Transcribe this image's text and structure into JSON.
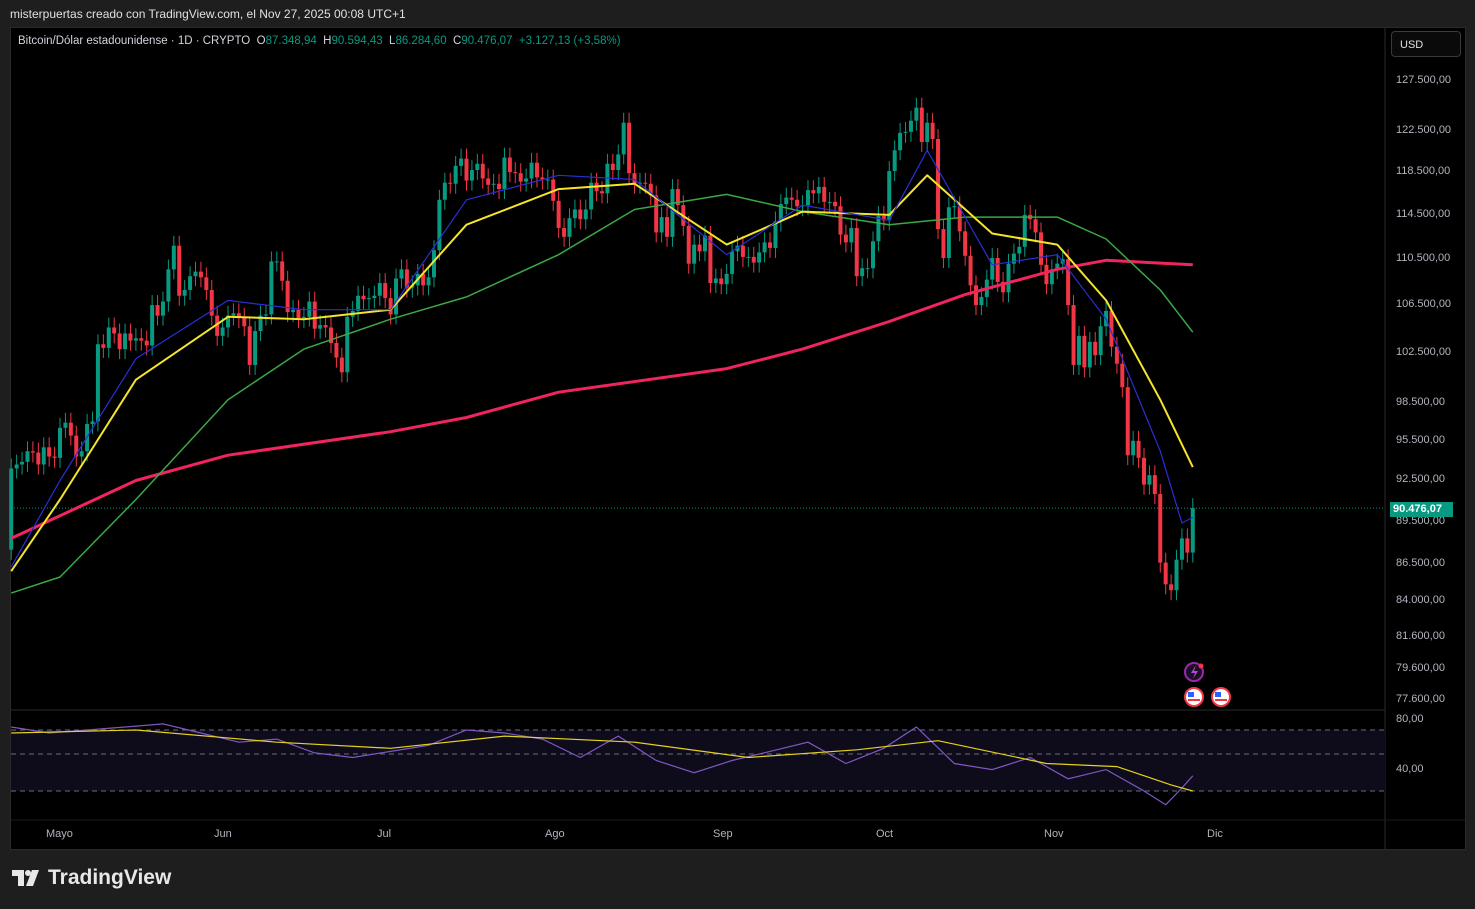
{
  "credit": "misterpuertas creado con TradingView.com, el Nov 27, 2025 00:08 UTC+1",
  "legend": {
    "symbol": "Bitcoin/Dólar estadounidense · 1D · CRYPTO",
    "o_label": "O",
    "o": "87.348,94",
    "h_label": "H",
    "h": "90.594,43",
    "l_label": "L",
    "l": "86.284,60",
    "c_label": "C",
    "c": "90.476,07",
    "change": "+3.127,13 (+3,58%)"
  },
  "currency": "USD",
  "last_price": "90.476,07",
  "colors": {
    "up": "#089981",
    "down": "#f23645",
    "ma10": "#2a2fd6",
    "ma20": "#f5e52a",
    "ma50": "#3aa845",
    "ma200": "#f0245e",
    "rsi": "#7e57c2",
    "rsi_ma": "#e6d21e"
  },
  "price_axis": [
    "127.500,00",
    "122.500,00",
    "118.500,00",
    "114.500,00",
    "110.500,00",
    "106.500,00",
    "102.500,00",
    "98.500,00",
    "95.500,00",
    "92.500,00",
    "89.500,00",
    "86.500,00",
    "84.000,00",
    "81.600,00",
    "79.600,00",
    "77.600,00"
  ],
  "rsi_axis": [
    "80,00",
    "40,00"
  ],
  "time_axis": [
    "Mayo",
    "Jun",
    "Jul",
    "Ago",
    "Sep",
    "Oct",
    "Nov",
    "Dic"
  ],
  "brand": "TradingView",
  "chart_data": {
    "type": "candlestick",
    "scale": "log",
    "ylim": [
      77000,
      128500
    ],
    "start_date": "2025-04-22",
    "first_open": 87500,
    "closes": [
      93.4,
      93.7,
      93.9,
      94.7,
      94.6,
      93.7,
      95.0,
      94.3,
      94.2,
      96.5,
      96.9,
      95.9,
      94.3,
      94.7,
      96.8,
      97.0,
      103.2,
      102.9,
      104.6,
      104.1,
      102.8,
      104.1,
      103.5,
      103.7,
      103.5,
      103.1,
      106.5,
      105.6,
      106.8,
      109.6,
      111.7,
      107.3,
      107.8,
      109.0,
      109.4,
      108.9,
      107.8,
      105.6,
      103.9,
      104.6,
      105.6,
      105.8,
      105.4,
      104.7,
      101.5,
      104.3,
      105.6,
      105.7,
      110.3,
      110.3,
      108.6,
      105.9,
      106.1,
      105.4,
      105.5,
      106.8,
      104.5,
      104.8,
      104.6,
      103.3,
      102.1,
      100.9,
      105.5,
      106.0,
      107.3,
      107.0,
      107.1,
      107.3,
      108.4,
      107.1,
      105.7,
      108.8,
      109.6,
      108.0,
      108.2,
      109.2,
      108.2,
      108.9,
      111.3,
      115.9,
      117.5,
      117.4,
      119.1,
      119.8,
      117.7,
      118.7,
      119.3,
      117.9,
      117.3,
      117.4,
      116.9,
      119.9,
      118.5,
      118.4,
      117.6,
      117.9,
      119.4,
      118.0,
      117.8,
      117.8,
      115.8,
      113.3,
      112.5,
      114.2,
      115.0,
      114.1,
      115.0,
      117.5,
      116.7,
      116.5,
      119.3,
      118.7,
      120.2,
      123.3,
      118.4,
      117.4,
      117.5,
      117.4,
      116.3,
      112.9,
      114.3,
      112.5,
      116.9,
      115.4,
      113.5,
      110.1,
      111.8,
      111.2,
      112.6,
      108.4,
      108.8,
      108.3,
      109.2,
      111.2,
      111.7,
      110.7,
      110.7,
      110.2,
      111.1,
      112.0,
      111.5,
      113.9,
      115.5,
      116.1,
      115.9,
      115.3,
      115.4,
      116.8,
      116.5,
      117.1,
      115.7,
      115.7,
      115.3,
      112.7,
      112.0,
      113.3,
      109.0,
      109.7,
      109.7,
      112.1,
      114.4,
      114.0,
      118.6,
      120.6,
      122.3,
      122.4,
      123.5,
      124.8,
      121.4,
      123.3,
      121.7,
      113.2,
      110.6,
      115.2,
      115.3,
      113.0,
      110.8,
      108.2,
      106.5,
      107.2,
      108.7,
      110.6,
      108.5,
      107.6,
      110.1,
      111.0,
      111.6,
      114.5,
      114.1,
      112.9,
      110.0,
      108.3,
      109.6,
      110.1,
      110.5,
      106.5,
      101.5,
      103.9,
      101.3,
      103.4,
      102.3,
      104.7,
      106.0,
      103.0,
      101.6,
      99.7,
      94.4,
      95.5,
      94.2,
      92.2,
      92.9,
      91.5,
      86.6,
      85.1,
      84.7,
      86.8,
      88.3,
      87.3,
      90.476
    ],
    "close_units": "thousands USD",
    "moving_averages": [
      {
        "key": "ma200",
        "points": [
          [
            "2025-04-22",
            88.3
          ],
          [
            "2025-05-15",
            92.5
          ],
          [
            "2025-06-01",
            94.4
          ],
          [
            "2025-07-01",
            96.2
          ],
          [
            "2025-07-15",
            97.3
          ],
          [
            "2025-08-01",
            99.3
          ],
          [
            "2025-09-01",
            101.2
          ],
          [
            "2025-09-15",
            102.8
          ],
          [
            "2025-10-01",
            105.1
          ],
          [
            "2025-10-15",
            107.4
          ],
          [
            "2025-11-01",
            109.6
          ],
          [
            "2025-11-10",
            110.4
          ],
          [
            "2025-11-26",
            110.0
          ]
        ]
      },
      {
        "key": "ma50",
        "points": [
          [
            "2025-04-22",
            84.5
          ],
          [
            "2025-05-01",
            85.6
          ],
          [
            "2025-05-15",
            91.1
          ],
          [
            "2025-06-01",
            98.7
          ],
          [
            "2025-06-15",
            102.8
          ],
          [
            "2025-07-01",
            105.3
          ],
          [
            "2025-07-15",
            107.2
          ],
          [
            "2025-08-01",
            110.9
          ],
          [
            "2025-08-15",
            115.0
          ],
          [
            "2025-09-01",
            116.4
          ],
          [
            "2025-09-15",
            114.8
          ],
          [
            "2025-10-01",
            113.6
          ],
          [
            "2025-10-15",
            114.3
          ],
          [
            "2025-11-01",
            114.3
          ],
          [
            "2025-11-10",
            112.3
          ],
          [
            "2025-11-20",
            107.8
          ],
          [
            "2025-11-26",
            104.2
          ]
        ]
      },
      {
        "key": "ma20",
        "points": [
          [
            "2025-04-22",
            86.0
          ],
          [
            "2025-05-01",
            91.1
          ],
          [
            "2025-05-15",
            100.3
          ],
          [
            "2025-06-01",
            105.5
          ],
          [
            "2025-06-15",
            105.3
          ],
          [
            "2025-07-01",
            106.1
          ],
          [
            "2025-07-15",
            113.6
          ],
          [
            "2025-08-01",
            116.9
          ],
          [
            "2025-08-15",
            117.4
          ],
          [
            "2025-09-01",
            111.8
          ],
          [
            "2025-09-15",
            114.8
          ],
          [
            "2025-10-01",
            114.5
          ],
          [
            "2025-10-08",
            118.2
          ],
          [
            "2025-10-20",
            112.8
          ],
          [
            "2025-11-01",
            111.8
          ],
          [
            "2025-11-10",
            106.9
          ],
          [
            "2025-11-20",
            98.7
          ],
          [
            "2025-11-26",
            93.5
          ]
        ]
      },
      {
        "key": "ma10",
        "points": [
          [
            "2025-04-22",
            86.3
          ],
          [
            "2025-05-01",
            92.5
          ],
          [
            "2025-05-15",
            102.0
          ],
          [
            "2025-06-01",
            106.9
          ],
          [
            "2025-06-15",
            106.1
          ],
          [
            "2025-07-01",
            106.1
          ],
          [
            "2025-07-15",
            115.9
          ],
          [
            "2025-08-01",
            118.2
          ],
          [
            "2025-08-15",
            117.8
          ],
          [
            "2025-09-01",
            110.9
          ],
          [
            "2025-09-15",
            115.4
          ],
          [
            "2025-10-01",
            114.0
          ],
          [
            "2025-10-08",
            120.6
          ],
          [
            "2025-10-20",
            110.0
          ],
          [
            "2025-11-01",
            110.9
          ],
          [
            "2025-11-10",
            105.3
          ],
          [
            "2025-11-20",
            94.7
          ],
          [
            "2025-11-24",
            89.4
          ],
          [
            "2025-11-26",
            89.8
          ]
        ]
      }
    ],
    "rsi": {
      "levels": [
        70,
        50,
        30
      ],
      "values": [
        [
          "2025-04-22",
          72
        ],
        [
          "2025-04-29",
          68
        ],
        [
          "2025-05-06",
          70
        ],
        [
          "2025-05-13",
          72
        ],
        [
          "2025-05-20",
          74
        ],
        [
          "2025-05-27",
          68
        ],
        [
          "2025-06-03",
          62
        ],
        [
          "2025-06-10",
          64
        ],
        [
          "2025-06-17",
          55
        ],
        [
          "2025-06-24",
          52
        ],
        [
          "2025-07-01",
          56
        ],
        [
          "2025-07-08",
          60
        ],
        [
          "2025-07-15",
          70
        ],
        [
          "2025-07-22",
          68
        ],
        [
          "2025-07-29",
          64
        ],
        [
          "2025-08-05",
          52
        ],
        [
          "2025-08-12",
          66
        ],
        [
          "2025-08-19",
          50
        ],
        [
          "2025-08-26",
          42
        ],
        [
          "2025-09-02",
          50
        ],
        [
          "2025-09-09",
          56
        ],
        [
          "2025-09-16",
          62
        ],
        [
          "2025-09-23",
          48
        ],
        [
          "2025-09-30",
          58
        ],
        [
          "2025-10-06",
          72
        ],
        [
          "2025-10-13",
          48
        ],
        [
          "2025-10-20",
          44
        ],
        [
          "2025-10-27",
          52
        ],
        [
          "2025-11-03",
          38
        ],
        [
          "2025-11-10",
          44
        ],
        [
          "2025-11-17",
          30
        ],
        [
          "2025-11-21",
          21
        ],
        [
          "2025-11-24",
          32
        ],
        [
          "2025-11-26",
          40
        ]
      ],
      "ma": [
        [
          "2025-04-22",
          68
        ],
        [
          "2025-05-15",
          70
        ],
        [
          "2025-06-10",
          62
        ],
        [
          "2025-07-01",
          58
        ],
        [
          "2025-07-22",
          66
        ],
        [
          "2025-08-15",
          62
        ],
        [
          "2025-09-05",
          52
        ],
        [
          "2025-09-25",
          57
        ],
        [
          "2025-10-10",
          63
        ],
        [
          "2025-10-30",
          48
        ],
        [
          "2025-11-12",
          46
        ],
        [
          "2025-11-22",
          34
        ],
        [
          "2025-11-26",
          30
        ]
      ]
    }
  }
}
